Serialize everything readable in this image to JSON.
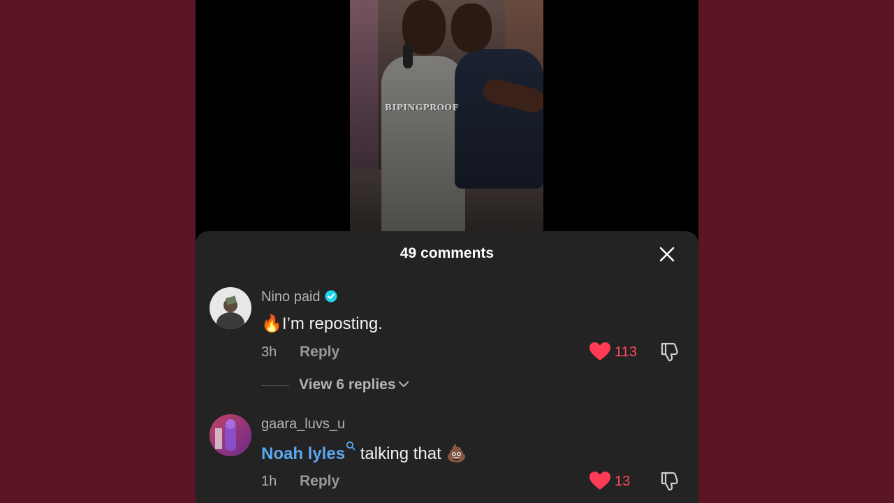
{
  "video": {
    "watermark": "BIPINGPROOF"
  },
  "comments_sheet": {
    "title": "49 comments",
    "close_icon": "close-icon"
  },
  "comments": [
    {
      "username": "Nino paid",
      "verified": true,
      "emoji": "🔥",
      "text": "I’m reposting.",
      "time": "3h",
      "reply_label": "Reply",
      "likes": "113",
      "liked": true,
      "view_replies": "View 6 replies"
    },
    {
      "username": "gaara_luvs_u",
      "verified": false,
      "mention": "Noah lyles",
      "text": " talking that ",
      "emoji": "💩",
      "time": "1h",
      "reply_label": "Reply",
      "likes": "13",
      "liked": true
    }
  ],
  "colors": {
    "background": "#5a1624",
    "sheet": "#232323",
    "like": "#ff3b55",
    "mention": "#5aa8f0",
    "verified": "#20d5ec"
  }
}
